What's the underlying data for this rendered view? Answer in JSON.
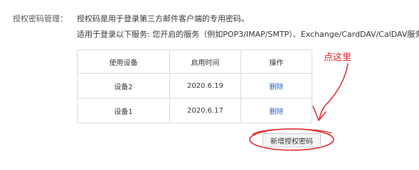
{
  "section_label": "授权密码管理：",
  "description": {
    "line1": "授权码是用于登录第三方邮件客户端的专用密码。",
    "line2": "适用于登录以下服务: 您开启的服务（例如POP3/IMAP/SMTP）、Exchange/CardDAV/CalDAV服务。"
  },
  "table": {
    "headers": [
      "使用设备",
      "启用时间",
      "操作"
    ],
    "rows": [
      {
        "device": "设备2",
        "time": "2020.6.19",
        "action": "删除"
      },
      {
        "device": "设备1",
        "time": "2020.6.17",
        "action": "删除"
      }
    ]
  },
  "add_button_label": "新增授权密码",
  "annotation": {
    "text": "点这里",
    "color": "#e02020"
  },
  "colors": {
    "link": "#2a62c9",
    "border": "#dadada"
  }
}
